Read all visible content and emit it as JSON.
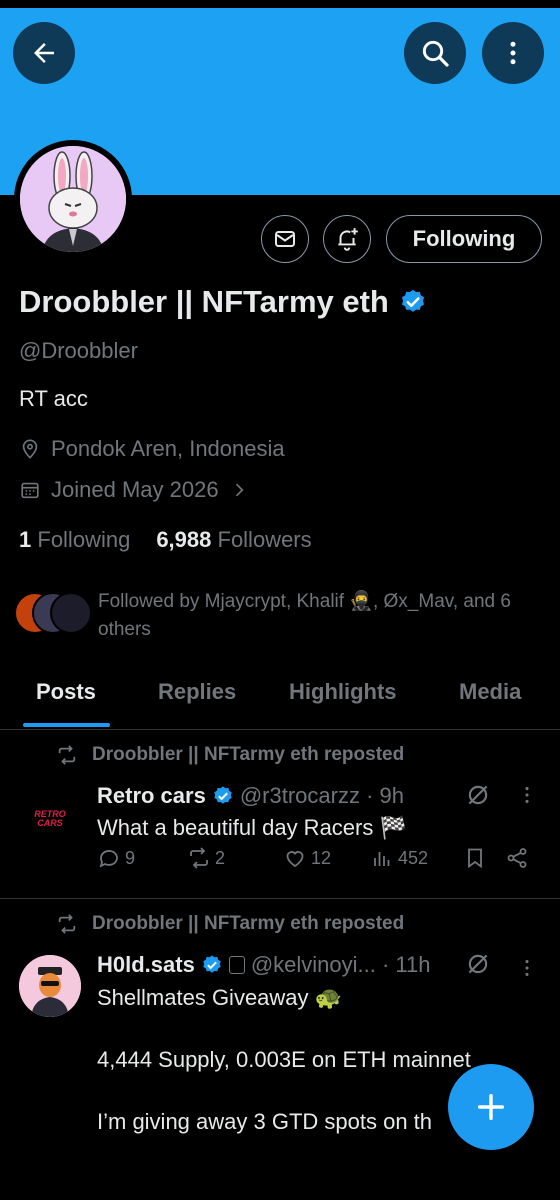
{
  "header": {
    "back_icon": "arrow-left-icon",
    "search_icon": "search-icon",
    "more_icon": "more-vertical-icon",
    "banner_color": "#1da1f2"
  },
  "profile": {
    "name": "Droobbler || NFTarmy eth",
    "handle": "@Droobbler",
    "bio": "RT acc",
    "location": "Pondok Aren, Indonesia",
    "joined": "Joined May 2026",
    "following_count": "1",
    "following_label": "Following",
    "followers_count": "6,988",
    "followers_label": "Followers",
    "followed_by": "Followed by Mjaycrypt, Khalif 🥷, Øx_Mav, and 6 others",
    "follow_button_label": "Following"
  },
  "tabs": [
    "Posts",
    "Replies",
    "Highlights",
    "Media"
  ],
  "posts": [
    {
      "repost_text": "Droobbler || NFTarmy eth reposted",
      "author": "Retro cars",
      "handle_time": "@r3trocarzz · 9h",
      "avatar_text": "RETRO CARS",
      "text_lines": [
        "What a beautiful day Racers 🏁"
      ],
      "replies": "9",
      "reposts": "2",
      "likes": "12",
      "views": "452"
    },
    {
      "repost_text": "Droobbler || NFTarmy eth reposted",
      "author": "H0ld.sats",
      "handle_time": "@kelvinoyi... · 11h",
      "text_lines": [
        "Shellmates Giveaway 🐢",
        "4,444 Supply, 0.003E on ETH mainnet",
        "I’m giving away 3 GTD spots on th"
      ]
    }
  ],
  "colors": {
    "accent": "#1d9bf0",
    "background": "#000000",
    "muted": "#71767b"
  }
}
